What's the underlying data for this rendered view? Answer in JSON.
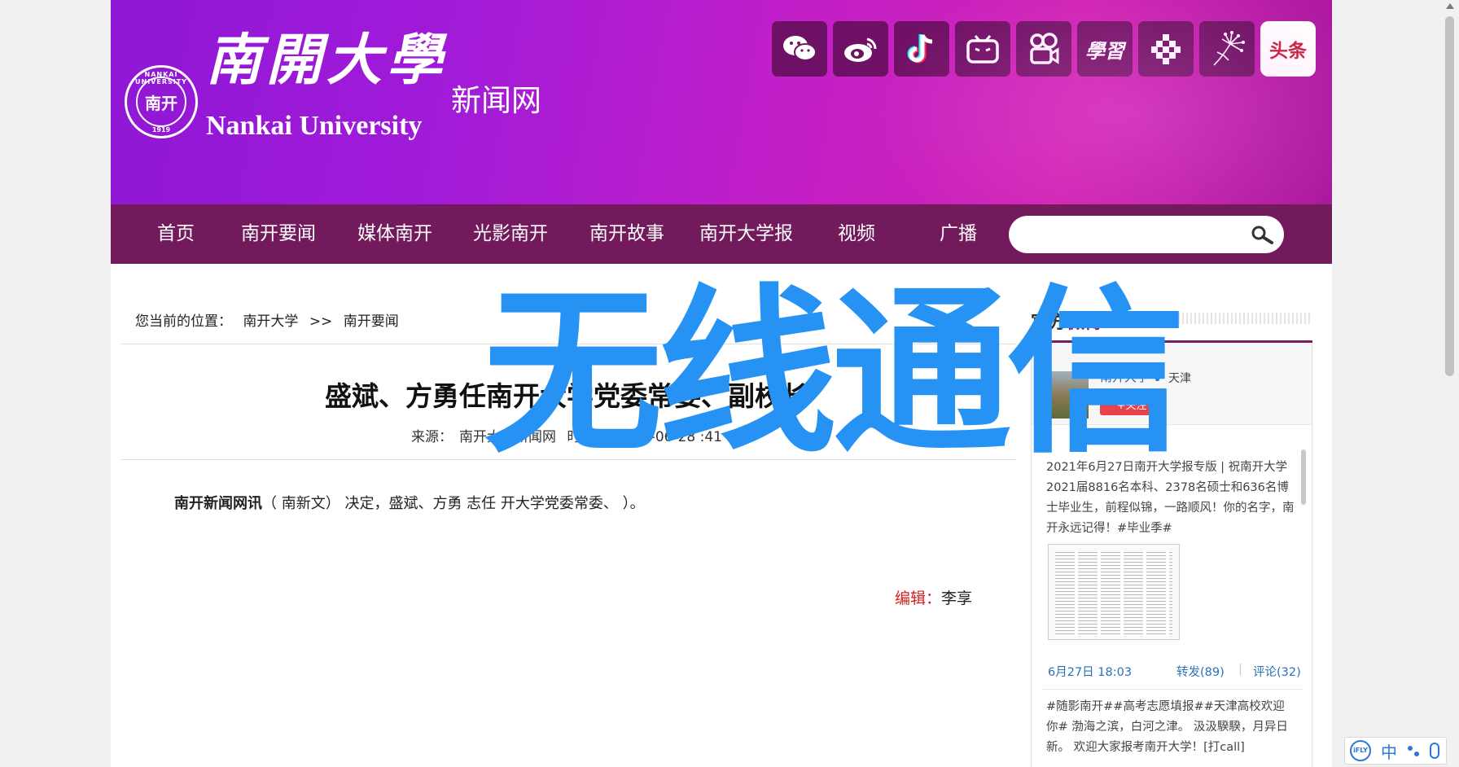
{
  "header": {
    "seal_ring": "NANKAI UNIVERSITY",
    "seal_core": "南开",
    "seal_year": "1919",
    "logo_cn": "南開大學",
    "logo_en": "Nankai University",
    "site_name": "新闻网",
    "social_icons": [
      {
        "name": "wechat-icon",
        "label": "微信"
      },
      {
        "name": "weibo-icon",
        "label": "微博"
      },
      {
        "name": "tiktok-icon",
        "label": "抖音"
      },
      {
        "name": "bilibili-icon",
        "label": "哔哩哔哩"
      },
      {
        "name": "kuaishou-icon",
        "label": "快手"
      },
      {
        "name": "xuexi-icon",
        "label": "学习"
      },
      {
        "name": "dots-app-icon",
        "label": "应用"
      },
      {
        "name": "dandelion-icon",
        "label": "蒲公英"
      },
      {
        "name": "toutiao-icon",
        "label": "头条"
      }
    ]
  },
  "nav": {
    "items": [
      "首页",
      "南开要闻",
      "媒体南开",
      "光影南开",
      "南开故事",
      "南开大学报",
      "视频",
      "广播"
    ],
    "search_placeholder": ""
  },
  "breadcrumb": {
    "label": "您当前的位置：",
    "items": [
      "南开大学",
      "南开要闻"
    ]
  },
  "article": {
    "title": "盛斌、方勇任南开大学党委常委、副校长",
    "source_label": "来源：",
    "source": "南开大学新闻网",
    "time_label": "时间：",
    "time": "2021-06-28 :41",
    "lead": "南开新闻网讯",
    "body_visible": "（ 南新文）  决定，盛斌、方勇  志任  开大学党委常委、       ）。",
    "editor_label": "编辑：",
    "editor": "李享"
  },
  "sidebar": {
    "title_prefix": "官方",
    "title_highlight": "微博",
    "account_name": "南开大学",
    "account_location": "天津",
    "follow_label": "+关注",
    "post1_text": "2021年6月27日南开大学报专版 | 祝南开大学2021届8816名本科、2378名硕士和636名博士毕业生，前程似锦，一路顺风！你的名字，南开永远记得！#毕业季#",
    "post1_time": "6月27日 18:03",
    "post1_reposts": "转发(89)",
    "post1_sep": "|",
    "post1_comments": "评论(32)",
    "post2_text": "#随影南开##高考志愿填报##天津高校欢迎你# 渤海之滨，白河之津。 汲汲騤騤，月异日新。 欢迎大家报考南开大学！[打call]"
  },
  "overlay": {
    "watermark": "无线通信",
    "watermark_color": "#2693f4"
  },
  "ime": {
    "brand": "iFLY",
    "mode": "中"
  },
  "colors": {
    "banner_start": "#8f17d6",
    "banner_end": "#cf21b2",
    "nav_bg": "#721a5c",
    "editor_label": "#d42020",
    "link_blue": "#2a71b8"
  }
}
